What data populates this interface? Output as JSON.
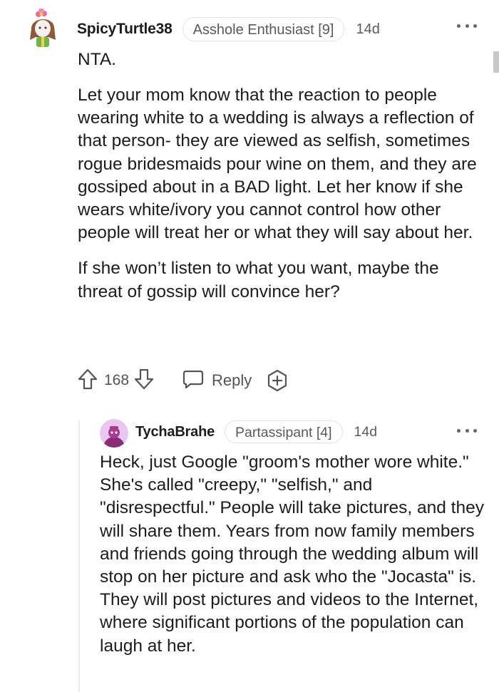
{
  "comment": {
    "username": "SpicyTurtle38",
    "flair": "Asshole Enthusiast [9]",
    "age": "14d",
    "verdict": "NTA.",
    "paragraphs": [
      "Let your mom know that the reaction to people wearing white to a wedding is always a reflection of that person- they are viewed as selfish, sometimes rogue bridesmaids pour wine on them, and they are gossiped about in a BAD light. Let her know if she wears white/ivory you cannot control how other people will treat her or what they will say about her.",
      "If she won’t listen to what you want, maybe the threat of gossip will convince her?"
    ],
    "votes": "168",
    "reply_label": "Reply",
    "icons": [
      "upvote-icon",
      "downvote-icon",
      "reply-icon",
      "award-icon",
      "more-options-icon"
    ]
  },
  "reply": {
    "username": "TychaBrahe",
    "flair": "Partassipant [4]",
    "age": "14d",
    "text": "Heck, just Google \"groom's mother wore white.\" She's called \"creepy,\" \"selfish,\" and \"disrespectful.\" People will take pictures, and they will share them. Years from now family members and friends going through the wedding album will stop on her picture and ask who the \"Jocasta\" is. They will post pictures and videos to the Internet, where significant portions of the population can laugh at her."
  },
  "colors": {
    "text": "#1c1c1c",
    "muted": "#555555",
    "flair_border": "#e3e3e3",
    "reply_avatar_bg": "#e7c6f0"
  }
}
